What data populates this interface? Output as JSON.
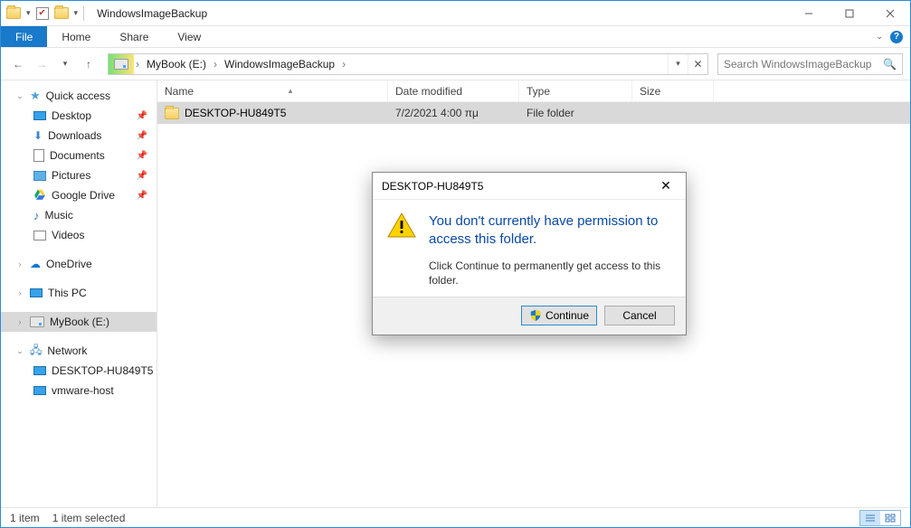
{
  "titlebar": {
    "title": "WindowsImageBackup"
  },
  "ribbon": {
    "file": "File",
    "tabs": [
      "Home",
      "Share",
      "View"
    ]
  },
  "address": {
    "crumbs": [
      "MyBook (E:)",
      "WindowsImageBackup"
    ]
  },
  "search": {
    "placeholder": "Search WindowsImageBackup"
  },
  "sidebar": {
    "quick_access": "Quick access",
    "items_quick": [
      {
        "label": "Desktop",
        "pinned": true
      },
      {
        "label": "Downloads",
        "pinned": true
      },
      {
        "label": "Documents",
        "pinned": true
      },
      {
        "label": "Pictures",
        "pinned": true
      },
      {
        "label": "Google Drive",
        "pinned": true
      },
      {
        "label": "Music",
        "pinned": false
      },
      {
        "label": "Videos",
        "pinned": false
      }
    ],
    "onedrive": "OneDrive",
    "this_pc": "This PC",
    "drive": "MyBook (E:)",
    "network": "Network",
    "net_items": [
      "DESKTOP-HU849T5",
      "vmware-host"
    ]
  },
  "columns": {
    "name": "Name",
    "date": "Date modified",
    "type": "Type",
    "size": "Size"
  },
  "rows": [
    {
      "name": "DESKTOP-HU849T5",
      "date": "7/2/2021 4:00 πμ",
      "type": "File folder",
      "size": ""
    }
  ],
  "status": {
    "count": "1 item",
    "selection": "1 item selected"
  },
  "dialog": {
    "title": "DESKTOP-HU849T5",
    "main": "You don't currently have permission to access this folder.",
    "sub": "Click Continue to permanently get access to this folder.",
    "continue": "Continue",
    "cancel": "Cancel"
  }
}
